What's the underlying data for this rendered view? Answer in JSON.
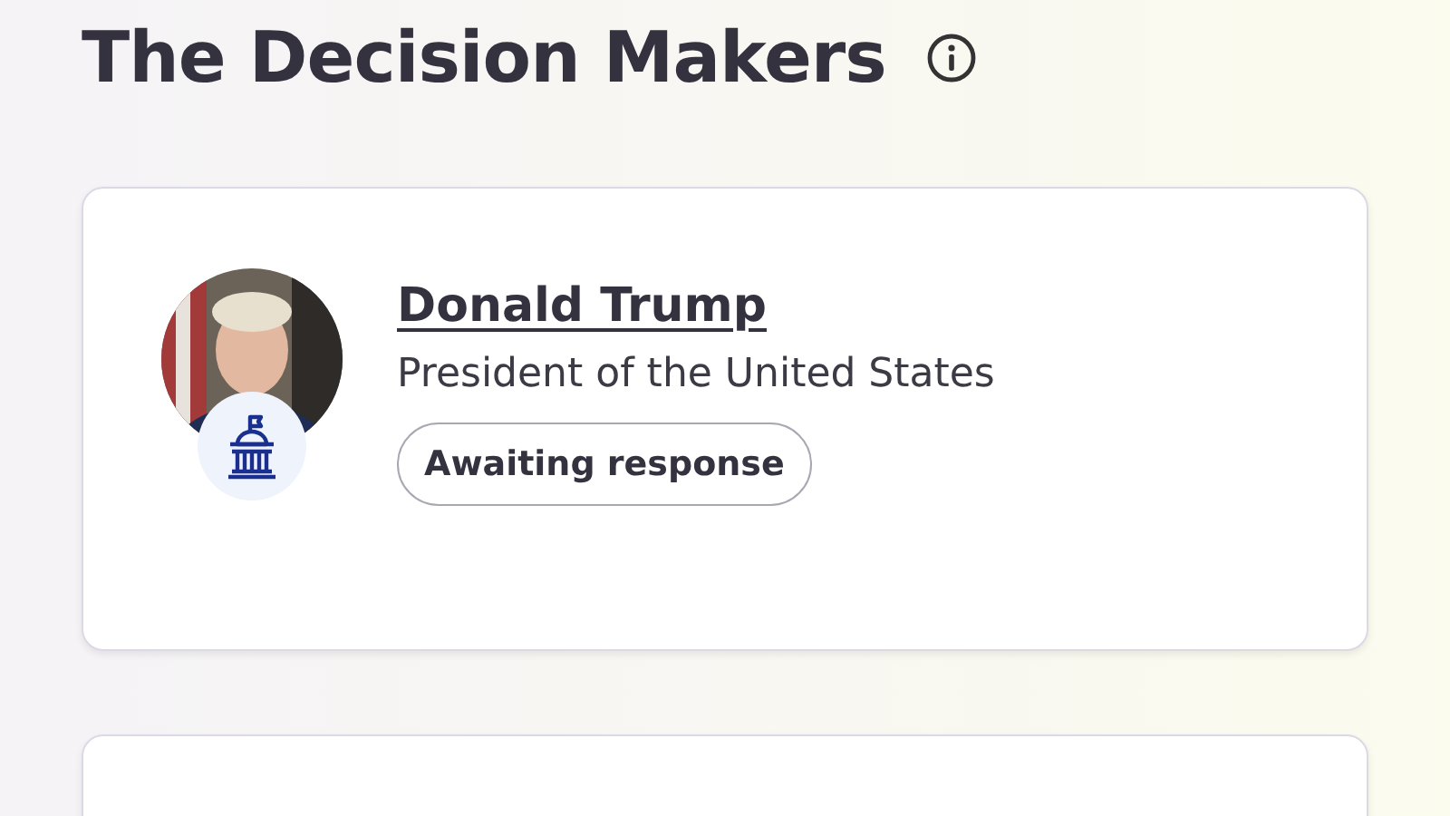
{
  "title": "The Decision Makers",
  "decision_makers": [
    {
      "name": "Donald Trump",
      "role": "President of the United States",
      "status": "Awaiting response"
    }
  ]
}
